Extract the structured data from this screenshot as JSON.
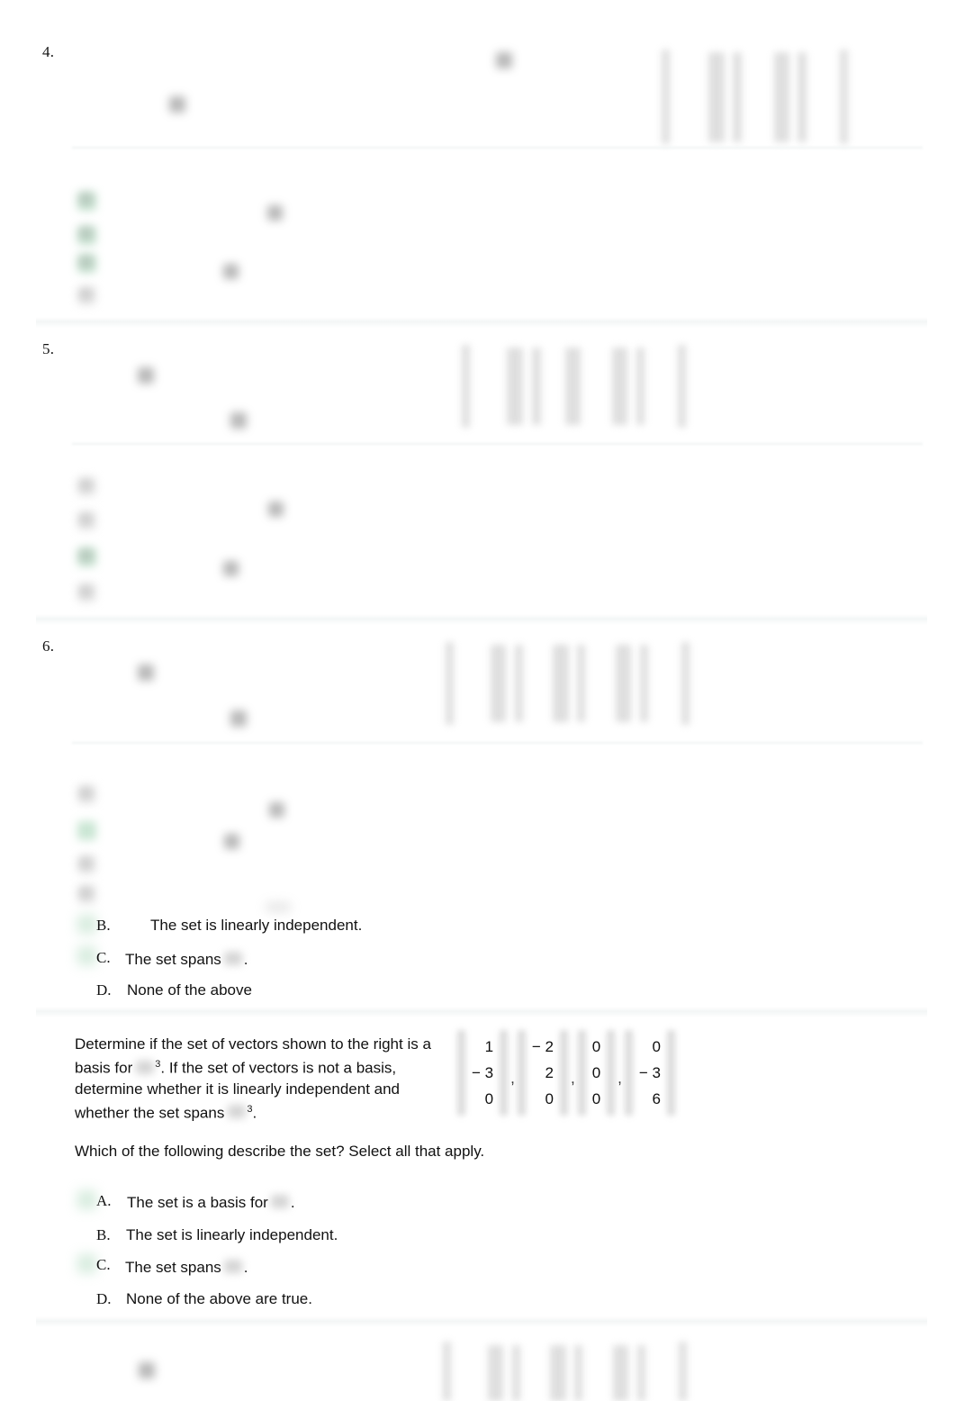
{
  "document": {
    "type": "homework-answer-key",
    "background": "#ffffff",
    "accent_check_color": "#b7ddc4"
  },
  "questions": [
    {
      "number": "4."
    },
    {
      "number": "5."
    },
    {
      "number": "6."
    }
  ],
  "question6_options": [
    {
      "letter": "B.",
      "text": "The set is linearly independent.",
      "checked": true,
      "has_r_symbol": false
    },
    {
      "letter": "C.",
      "text_before": "The set spans",
      "text_after": ".",
      "checked": true,
      "has_r_symbol": true
    },
    {
      "letter": "D.",
      "text": "None of the above",
      "checked": false,
      "has_r_symbol": false
    }
  ],
  "question7": {
    "prompt_line1": "Determine if the set of vectors shown to the right is a",
    "prompt_line2_a": "basis for",
    "prompt_line2_sup": "3",
    "prompt_line2_b": ". If the set of vectors is not a basis,",
    "prompt_line3": "determine whether it is linearly independent and",
    "prompt_line4_a": "whether the set spans",
    "prompt_line4_sup": "3",
    "prompt_line4_b": ".",
    "instruction": "Which of the following describe the set? Select all that apply.",
    "vectors": [
      [
        "1",
        "− 3",
        "0"
      ],
      [
        "− 2",
        "2",
        "0"
      ],
      [
        "0",
        "0",
        "0"
      ],
      [
        "0",
        "− 3",
        "6"
      ]
    ],
    "separators": [
      ",",
      ",",
      ","
    ],
    "options": [
      {
        "letter": "A.",
        "text_before": "The set is a basis for",
        "text_after": ".",
        "checked": false,
        "has_r_symbol": true
      },
      {
        "letter": "B.",
        "text": "The set is linearly independent.",
        "checked": false,
        "has_r_symbol": false
      },
      {
        "letter": "C.",
        "text_before": "The set spans",
        "text_after": ".",
        "checked": true,
        "has_r_symbol": true
      },
      {
        "letter": "D.",
        "text": "None of the above are true.",
        "checked": false,
        "has_r_symbol": false
      }
    ]
  }
}
